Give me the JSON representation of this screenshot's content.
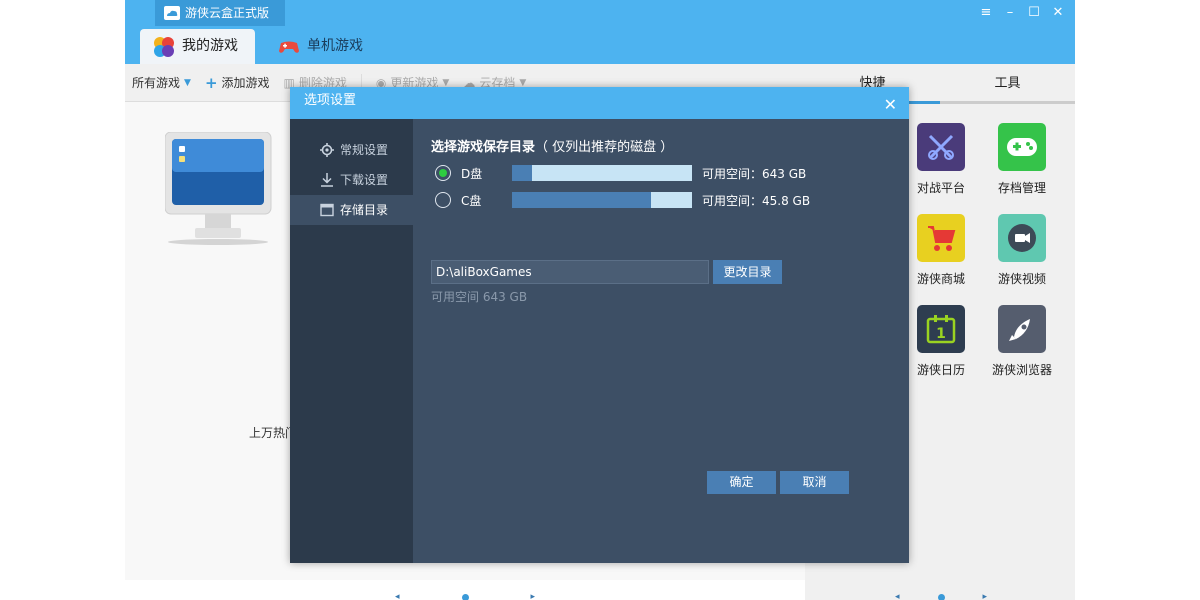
{
  "window": {
    "title": "游侠云盒正式版",
    "controls": [
      "menu-icon",
      "minimize-icon",
      "maximize-icon",
      "close-icon"
    ]
  },
  "tabs": [
    {
      "label": "我的游戏",
      "icon": "my-games-icon",
      "active": true
    },
    {
      "label": "单机游戏",
      "icon": "gamepad-icon",
      "active": false
    }
  ],
  "toolbar": {
    "all_games": "所有游戏",
    "add_game": "添加游戏",
    "delete_game": "删除游戏",
    "update_game": "更新游戏",
    "cloud_save": "云存档"
  },
  "left_pane": {
    "hot_text": "上万热门"
  },
  "right_pane": {
    "tabs": [
      {
        "label": "快捷",
        "active": true
      },
      {
        "label": "工具",
        "active": false
      }
    ],
    "shortcuts": [
      {
        "label": "对战平台",
        "icon": "battle-platform-icon",
        "color": "#4a3b7a"
      },
      {
        "label": "存档管理",
        "icon": "save-manager-icon",
        "color": "#35c34a"
      },
      {
        "label": "游侠商城",
        "icon": "shopping-cart-icon",
        "color": "#e8d020"
      },
      {
        "label": "游侠视频",
        "icon": "video-icon",
        "color": "#5fc8b0"
      },
      {
        "label": "游侠日历",
        "icon": "calendar-icon",
        "color": "#2e3d50"
      },
      {
        "label": "游侠浏览器",
        "icon": "rocket-icon",
        "color": "#555d6e"
      }
    ]
  },
  "dialog": {
    "title": "选项设置",
    "sidebar": [
      {
        "label": "常规设置",
        "icon": "gear-icon",
        "active": false
      },
      {
        "label": "下载设置",
        "icon": "download-icon",
        "active": false
      },
      {
        "label": "存储目录",
        "icon": "folder-icon",
        "active": true
      }
    ],
    "section_title": "选择游戏保存目录",
    "section_note": "（ 仅列出推荐的磁盘 ）",
    "drives": [
      {
        "label": "D盘",
        "selected": true,
        "used_fraction": 0.11,
        "free_text": "可用空间：643 GB"
      },
      {
        "label": "C盘",
        "selected": false,
        "used_fraction": 0.77,
        "free_text": "可用空间：45.8 GB"
      }
    ],
    "path_value": "D:\\aliBoxGames",
    "change_button": "更改目录",
    "free_hint": "可用空间 643 GB",
    "ok_button": "确定",
    "cancel_button": "取消"
  },
  "colors": {
    "accent": "#4db3f0",
    "dialog_bg": "#3d4f65",
    "dialog_sidebar": "#2c3a4b",
    "button": "#4a7fb4"
  }
}
